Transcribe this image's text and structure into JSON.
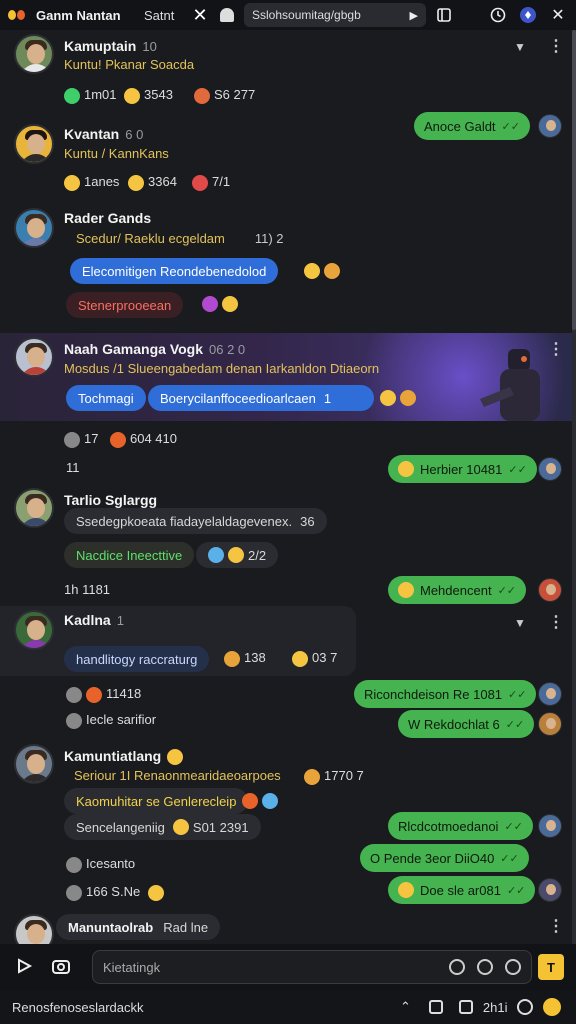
{
  "topbar": {
    "title": "Ganm Nantan",
    "tab": "Satnt",
    "url": "Sslohsoumitag/gbgb",
    "close": "✕"
  },
  "colors": {
    "bg": "#1a1b1e",
    "green": "#45b34f",
    "blue": "#2f6ed8",
    "accent": "#f4c233"
  },
  "messages": [
    {
      "name": "Kamuptain",
      "meta": "10",
      "sub": "Kuntu! Pkanar Soacda",
      "reactions": [
        {
          "emoji": "sparkle-green",
          "text": "1m01"
        },
        {
          "emoji": "grin",
          "text": "3543"
        },
        {
          "emoji": "pencil",
          "text": "S6 277"
        }
      ]
    },
    {
      "name": "Kvantan",
      "meta": "6 0",
      "sub": "Kuntu / KannKans",
      "reactions": [
        {
          "emoji": "grin",
          "text": "1anes"
        },
        {
          "emoji": "grin",
          "text": "3364"
        },
        {
          "emoji": "fire",
          "text": "7/1"
        }
      ]
    },
    {
      "name": "Rader Gands",
      "sub": "Scedur/ Raeklu ecgeldam",
      "sub_tail": "11) 2",
      "pill_blue": "Elecomitigen Reondebenedolod",
      "pill_red": "Stenerprooeean"
    },
    {
      "name": "Naah Gamanga Vogk",
      "meta": "06 2 0",
      "sub": "Mosdus /1 Slueengabedam denan Iarkanldon Dtiaeorn",
      "pill_a": "Tochmagi",
      "pill_b": "Boerycilanffoceedioarlcaen",
      "pill_b_count": "1",
      "reactions": [
        {
          "emoji": "thumb",
          "text": "17"
        },
        {
          "emoji": "grin",
          "text": "604 410"
        }
      ],
      "count": "11"
    },
    {
      "name": "Tarlio Sglargg",
      "sub": "Ssedegpkoeata fiadayelaldagevenex.",
      "sub_tail": "36",
      "pill_green": "Nacdice Ineecttive",
      "pill_tail": "2/2",
      "footer": "1h 1181"
    },
    {
      "name": "Kadlna",
      "meta": "1",
      "pill_blue": "handlitogy raccraturg",
      "reactions": [
        {
          "emoji": "fire",
          "text": "138"
        },
        {
          "emoji": "grin",
          "text": "03 7"
        }
      ],
      "footer_a": "11418",
      "footer_b": "Iecle sarifior"
    },
    {
      "name": "Kamuntiatlang",
      "sub": "Seriour 1I Renaonmearidaeoarpoes",
      "sub_tail": "1770 7",
      "sub2": "Kaomuhitar se Genlerecleip",
      "sub3": "Sencelangeniig",
      "sub3_tail": "S01 2391",
      "footer_a": "Icesanto",
      "footer_b": "166 S.Ne"
    },
    {
      "name": "Manuntaolrab",
      "sub": "Rad lne"
    }
  ],
  "outgoing": [
    "Anoce Galdt",
    "Herbier 10481",
    "Mehdencent",
    "Riconchdeison Re 1081",
    "W Rekdochlat 6",
    "Rlcdcotmoedanoi",
    "O Pende 3eor DiiO40",
    "Doe sle ar081"
  ],
  "composer": {
    "placeholder": "Kietatingk",
    "send": "T"
  },
  "statusbar": {
    "left": "Renosfenoseslardackk",
    "right": "2h1i"
  }
}
